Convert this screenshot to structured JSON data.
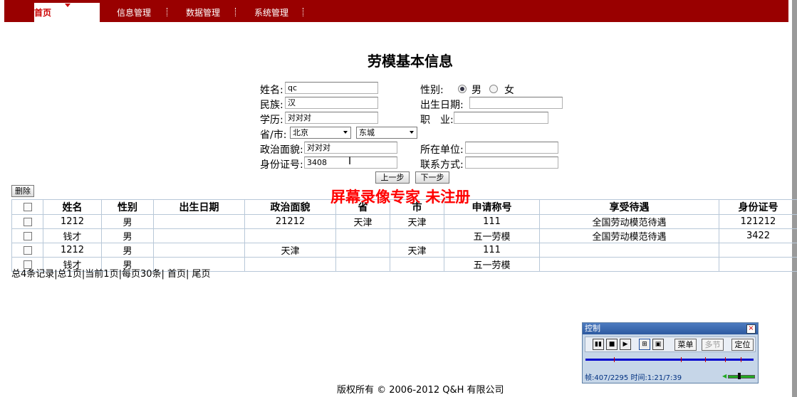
{
  "nav": {
    "home": "首页",
    "items": [
      "信息管理",
      "数据管理",
      "系统管理"
    ]
  },
  "form": {
    "title": "劳模基本信息",
    "name_label": "姓名:",
    "name_value": "qc",
    "gender_label": "性别:",
    "gender_male": "男",
    "gender_female": "女",
    "gender_selected": "男",
    "ethnicity_label": "民族:",
    "ethnicity_value": "汉",
    "birth_label": "出生日期:",
    "birth_value": "",
    "education_label": "学历:",
    "education_value": "对对对",
    "job_label": "职　业:",
    "job_value": "",
    "province_label": "省/市:",
    "province_value": "北京",
    "city_value": "东城",
    "political_label": "政治面貌:",
    "political_value": "对对对",
    "workplace_label": "所在单位:",
    "workplace_value": "",
    "id_label": "身份证号:",
    "id_value": "3408",
    "contact_label": "联系方式:",
    "contact_value": "",
    "prev_button": "上一步",
    "next_button": "下一步"
  },
  "table": {
    "delete_button": "删除",
    "columns": [
      "",
      "姓名",
      "性别",
      "出生日期",
      "政治面貌",
      "省",
      "市",
      "申请称号",
      "享受待遇",
      "身份证号"
    ],
    "rows": [
      [
        "",
        "1212",
        "男",
        "",
        "21212",
        "天津",
        "天津",
        "111",
        "全国劳动模范待遇",
        "121212"
      ],
      [
        "",
        "钱才",
        "男",
        "",
        "",
        "",
        "",
        "五一劳模",
        "全国劳动模范待遇",
        "3422"
      ],
      [
        "",
        "1212",
        "男",
        "",
        "天津",
        "",
        "天津",
        "111",
        "",
        ""
      ],
      [
        "",
        "钱才",
        "男",
        "",
        "",
        "",
        "",
        "五一劳模",
        "",
        ""
      ]
    ]
  },
  "pager": {
    "text": "总4条记录|总1页|当前1页|每页30条| 首页| 尾页"
  },
  "footer": {
    "text": "版权所有 © 2006-2012 Q&H 有限公司"
  },
  "watermark": "屏幕录像专家 未注册",
  "control": {
    "title": "控制",
    "close": "×",
    "menu_button": "菜单",
    "multi_button": "多节",
    "locate_button": "定位",
    "status": "帧:407/2295 时间:1:21/7:39"
  }
}
